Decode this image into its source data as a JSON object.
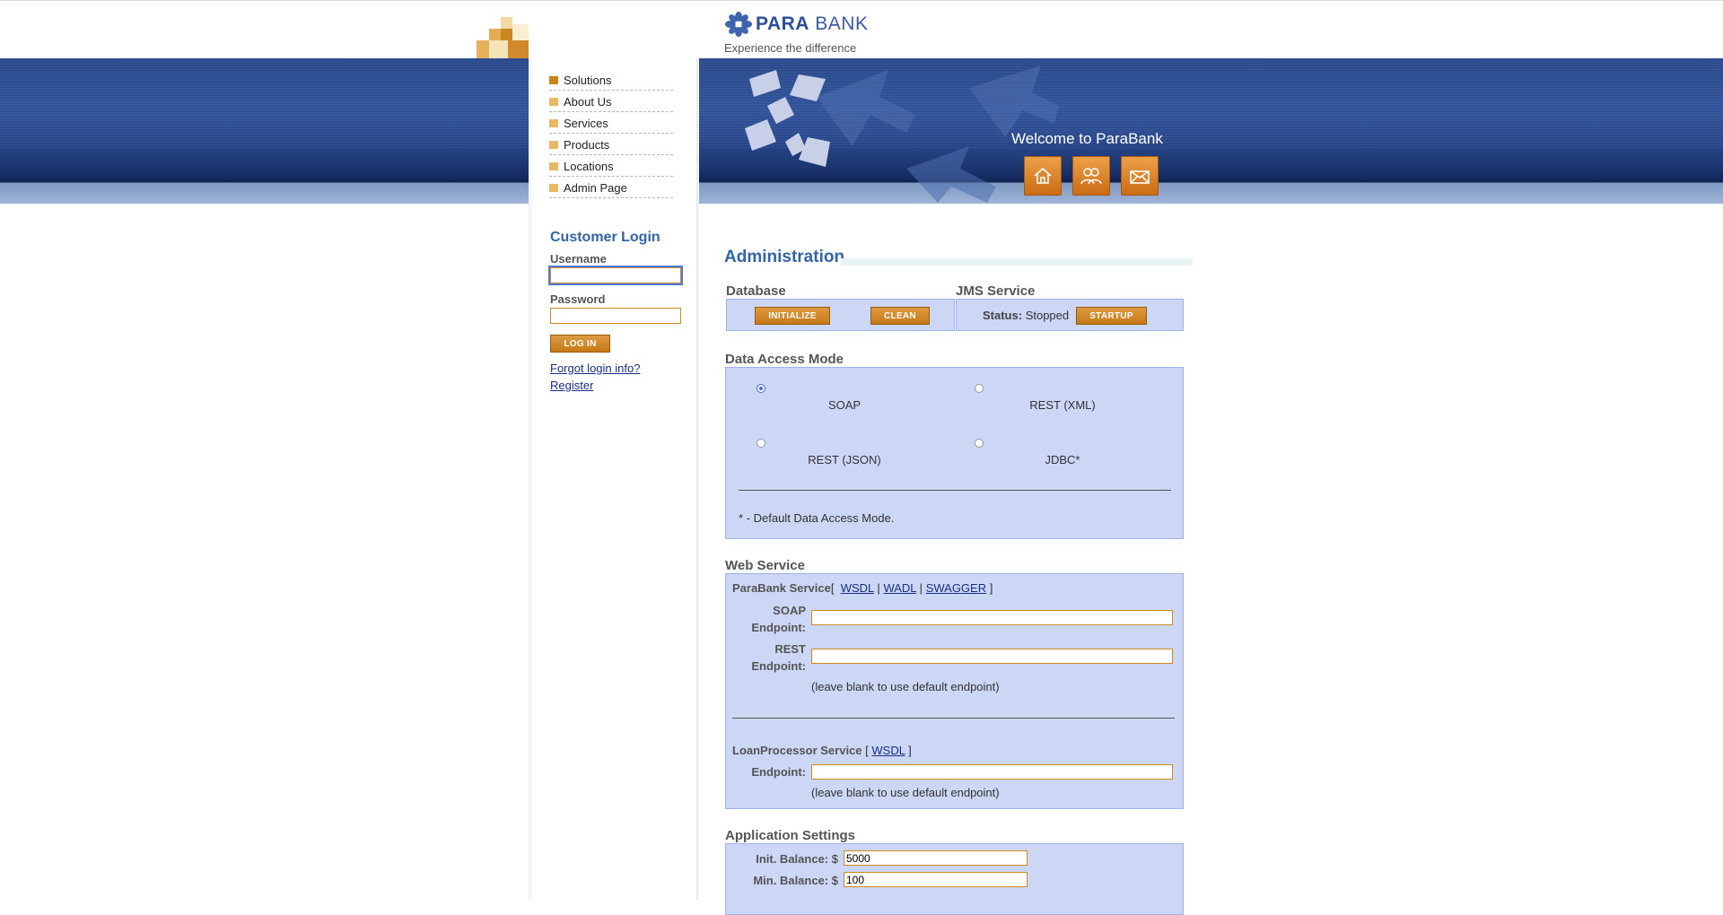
{
  "brand": {
    "name_bold": "PARA",
    "name_rest": "BANK",
    "tagline": "Experience the difference"
  },
  "nav": [
    {
      "label": "Solutions"
    },
    {
      "label": "About Us"
    },
    {
      "label": "Services"
    },
    {
      "label": "Products"
    },
    {
      "label": "Locations"
    },
    {
      "label": "Admin Page"
    }
  ],
  "header": {
    "welcome": "Welcome to ParaBank",
    "icons": [
      "home-icon",
      "contact-icon",
      "email-icon"
    ]
  },
  "login": {
    "title": "Customer Login",
    "username_label": "Username",
    "username_value": "",
    "password_label": "Password",
    "password_value": "",
    "login_button": "LOG IN",
    "forgot_link": "Forgot login info?",
    "register_link": "Register"
  },
  "admin": {
    "title": "Administration",
    "database": {
      "title": "Database",
      "initialize_button": "INITIALIZE",
      "clean_button": "CLEAN"
    },
    "jms": {
      "title": "JMS Service",
      "status_label": "Status:",
      "status_value": "Stopped",
      "startup_button": "STARTUP"
    },
    "data_access": {
      "title": "Data Access Mode",
      "options": [
        {
          "label": "SOAP",
          "checked": true
        },
        {
          "label": "REST (XML)",
          "checked": false
        },
        {
          "label": "REST (JSON)",
          "checked": false
        },
        {
          "label": "JDBC*",
          "checked": false
        }
      ],
      "note": "* - Default Data Access Mode."
    },
    "web_service": {
      "title": "Web Service",
      "parabank_label": "ParaBank Service",
      "bracket_open": "[",
      "bracket_close": "]",
      "pipe": "|",
      "wsdl": "WSDL",
      "wadl": "WADL",
      "swagger": "SWAGGER",
      "soap_label_1": "SOAP",
      "soap_label_2": "Endpoint:",
      "soap_value": "",
      "rest_label_1": "REST",
      "rest_label_2": "Endpoint:",
      "rest_value": "",
      "blank_note": "(leave blank to use default endpoint)",
      "loan_label": "LoanProcessor Service",
      "loan_wsdl": "WSDL",
      "loan_endpoint_label": "Endpoint:",
      "loan_value": "",
      "loan_note": "(leave blank to use default endpoint)"
    },
    "app_settings": {
      "title": "Application Settings",
      "init_balance_label": "Init. Balance:",
      "init_balance_currency": "$",
      "init_balance_value": "5000",
      "min_balance_label": "Min. Balance:",
      "min_balance_currency": "$",
      "min_balance_value": "100"
    }
  },
  "colors": {
    "accent_blue": "#3264a8",
    "orange": "#c67918",
    "panel": "#ccd6f5"
  }
}
